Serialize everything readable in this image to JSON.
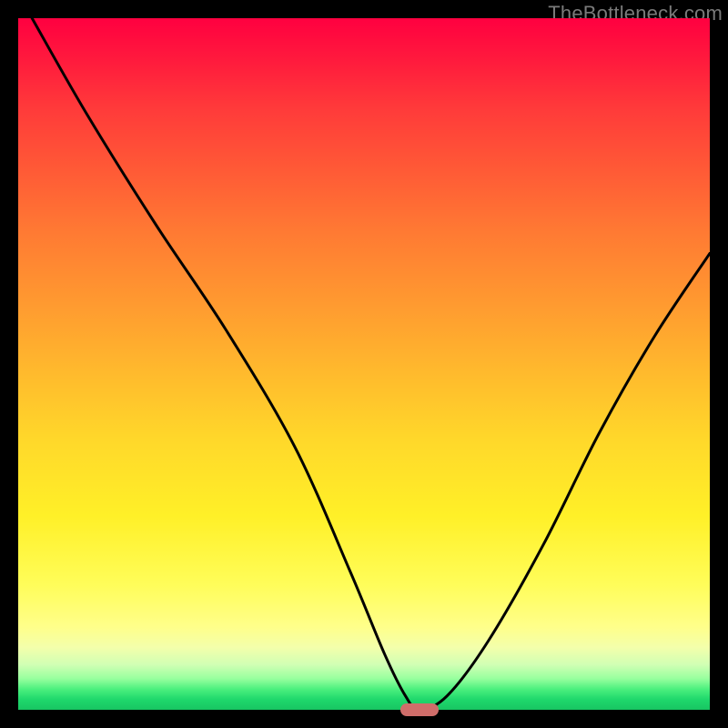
{
  "watermark": "TheBottleneck.com",
  "chart_data": {
    "type": "line",
    "title": "",
    "xlabel": "",
    "ylabel": "",
    "xlim": [
      0,
      100
    ],
    "ylim": [
      0,
      100
    ],
    "grid": false,
    "legend": false,
    "series": [
      {
        "name": "bottleneck-curve",
        "x": [
          2,
          10,
          20,
          30,
          40,
          48,
          53,
          56,
          58,
          62,
          68,
          76,
          84,
          92,
          100
        ],
        "y": [
          100,
          86,
          70,
          55,
          38,
          20,
          8,
          2,
          0,
          2,
          10,
          24,
          40,
          54,
          66
        ]
      }
    ],
    "marker": {
      "x": 58,
      "y": 0,
      "shape": "pill",
      "color": "#cf6d6a"
    },
    "gradient_stops": [
      {
        "pos": 0,
        "color": "#ff0040"
      },
      {
        "pos": 0.5,
        "color": "#ffd82a"
      },
      {
        "pos": 0.95,
        "color": "#4cf07e"
      },
      {
        "pos": 1.0,
        "color": "#18c562"
      }
    ]
  }
}
